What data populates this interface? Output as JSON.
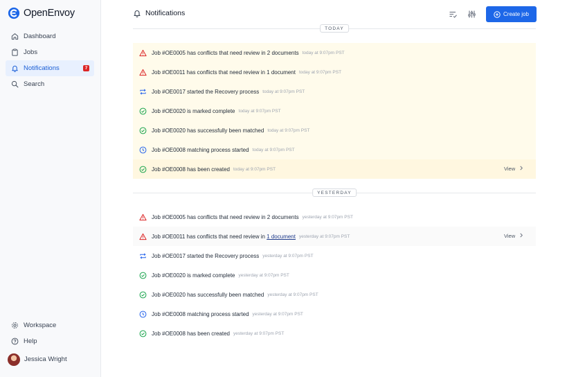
{
  "app": {
    "name": "OpenEnvoy"
  },
  "sidebar": {
    "items": [
      {
        "label": "Dashboard",
        "icon": "home-icon"
      },
      {
        "label": "Jobs",
        "icon": "clipboard-icon"
      },
      {
        "label": "Notifications",
        "icon": "bell-icon",
        "badge": "7",
        "active": true
      },
      {
        "label": "Search",
        "icon": "search-icon"
      }
    ],
    "bottom": [
      {
        "label": "Workspace",
        "icon": "gear-icon"
      },
      {
        "label": "Help",
        "icon": "help-icon"
      }
    ],
    "user": {
      "name": "Jessica Wright"
    }
  },
  "header": {
    "title": "Notifications",
    "create_label": "Create job"
  },
  "colors": {
    "accent": "#1d67e8",
    "unread_bg": "#fffbeb",
    "warning": "#dc2626",
    "success": "#16a34a",
    "info": "#2563eb",
    "recovery": "#2563eb"
  },
  "groups": [
    {
      "label": "TODAY",
      "items": [
        {
          "icon": "warning-icon",
          "prefix": "Job #OE0005 has conflicts that need review in ",
          "link": "2 documents",
          "suffix": "",
          "time": "today at 9:07pm PST"
        },
        {
          "icon": "warning-icon",
          "prefix": "Job #OE0011 has conflicts that need review in ",
          "link": "1 document",
          "suffix": "",
          "time": "today at 9:07pm PST"
        },
        {
          "icon": "recovery-icon",
          "prefix": "Job #OE0017 started the Recovery process",
          "link": "",
          "suffix": "",
          "time": "today at 9:07pm PST"
        },
        {
          "icon": "check-circle-icon",
          "prefix": "Job #OE0020 is marked complete",
          "link": "",
          "suffix": "",
          "time": "today at 9:07pm PST"
        },
        {
          "icon": "check-circle-icon",
          "prefix": "Job #OE0020 has successfully been matched",
          "link": "",
          "suffix": "",
          "time": "today at 9:07pm PST"
        },
        {
          "icon": "clock-icon",
          "prefix": "Job #OE0008 matching process started",
          "link": "",
          "suffix": "",
          "time": "today at 9:07pm PST"
        },
        {
          "icon": "check-circle-icon",
          "prefix": "Job #OE0008 has been created",
          "link": "",
          "suffix": "",
          "time": "today at 9:07pm PST",
          "view": "View"
        }
      ]
    },
    {
      "label": "YESTERDAY",
      "items": [
        {
          "icon": "warning-icon",
          "prefix": "Job #OE0005 has conflicts that need review in ",
          "link": "2 documents",
          "suffix": "",
          "time": "yesterday at 9:07pm PST"
        },
        {
          "icon": "warning-icon",
          "prefix": "Job #OE0011 has conflicts that need review in ",
          "link": "1 document",
          "suffix": "",
          "time": "yesterday at 9:07pm PST",
          "view": "View"
        },
        {
          "icon": "recovery-icon",
          "prefix": "Job #OE0017 started the Recovery process",
          "link": "",
          "suffix": "",
          "time": "yesterday at 9:07pm PST"
        },
        {
          "icon": "check-circle-icon",
          "prefix": "Job #OE0020 is marked complete",
          "link": "",
          "suffix": "",
          "time": "yesterday at 9:07pm PST"
        },
        {
          "icon": "check-circle-icon",
          "prefix": "Job #OE0020 has successfully been matched",
          "link": "",
          "suffix": "",
          "time": "yesterday at 9:07pm PST"
        },
        {
          "icon": "clock-icon",
          "prefix": "Job #OE0008 matching process started",
          "link": "",
          "suffix": "",
          "time": "yesterday at 9:07pm PST"
        },
        {
          "icon": "check-circle-icon",
          "prefix": "Job #OE0008 has been created",
          "link": "",
          "suffix": "",
          "time": "yesterday at 9:07pm PST"
        }
      ]
    }
  ]
}
